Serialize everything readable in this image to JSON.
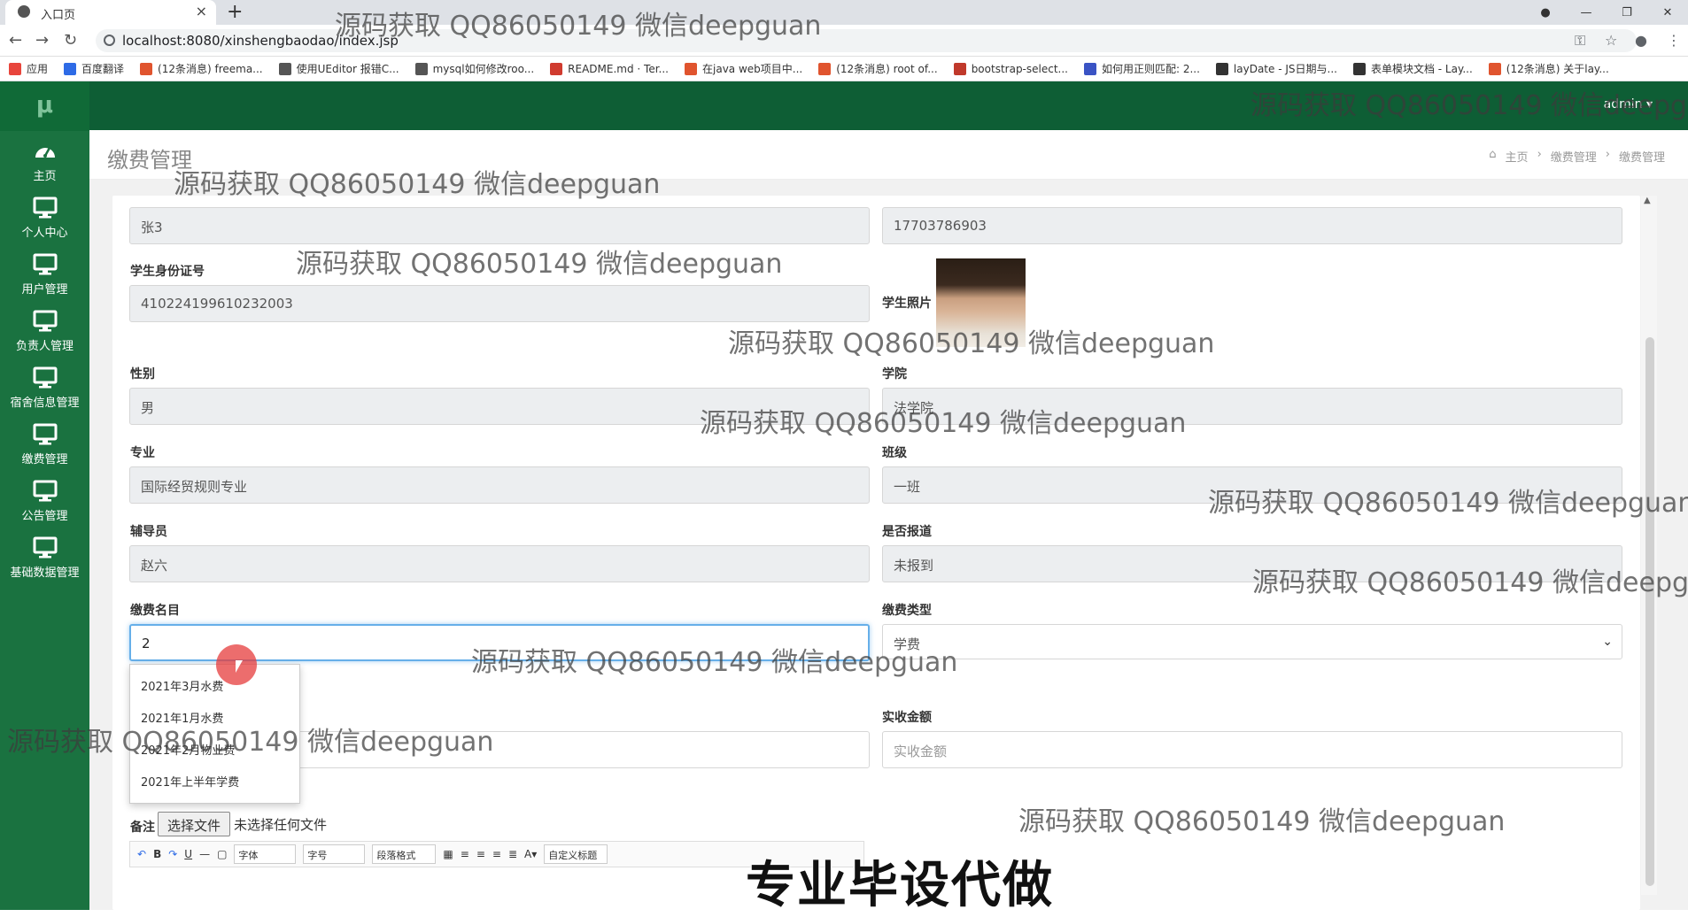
{
  "browser": {
    "tab_title": "入口页",
    "url": "localhost:8080/xinshengbaodao/index.jsp",
    "bookmarks": [
      {
        "label": "应用",
        "color": "#e8453c"
      },
      {
        "label": "百度翻译",
        "color": "#2e6be6"
      },
      {
        "label": "(12条消息) freema...",
        "color": "#e0542e"
      },
      {
        "label": "使用UEditor 报错C...",
        "color": "#555555"
      },
      {
        "label": "mysql如何修改roo...",
        "color": "#555555"
      },
      {
        "label": "README.md · Ter...",
        "color": "#d03b2f"
      },
      {
        "label": "在java web项目中...",
        "color": "#e0542e"
      },
      {
        "label": "(12条消息) root of...",
        "color": "#e0542e"
      },
      {
        "label": "bootstrap-select...",
        "color": "#c0392b"
      },
      {
        "label": "如何用正则匹配: 2...",
        "color": "#3a53c4"
      },
      {
        "label": "layDate - JS日期与...",
        "color": "#333333"
      },
      {
        "label": "表单模块文档 - Lay...",
        "color": "#333333"
      },
      {
        "label": "(12条消息) 关于lay...",
        "color": "#e0542e"
      }
    ]
  },
  "app": {
    "logo": "μ",
    "user": "admin ▾",
    "sidebar": [
      {
        "label": "主页",
        "icon": "dashboard-icon"
      },
      {
        "label": "个人中心",
        "icon": "monitor-icon"
      },
      {
        "label": "用户管理",
        "icon": "monitor-icon"
      },
      {
        "label": "负责人管理",
        "icon": "monitor-icon"
      },
      {
        "label": "宿舍信息管理",
        "icon": "monitor-icon"
      },
      {
        "label": "缴费管理",
        "icon": "monitor-icon"
      },
      {
        "label": "公告管理",
        "icon": "monitor-icon"
      },
      {
        "label": "基础数据管理",
        "icon": "monitor-icon"
      }
    ],
    "page_title": "缴费管理",
    "breadcrumb": [
      "主页",
      "缴费管理",
      "缴费管理"
    ]
  },
  "form": {
    "name_value": "张3",
    "phone_value": "17703786903",
    "idcard_label": "学生身份证号",
    "idcard_value": "410224199610232003",
    "photo_label": "学生照片",
    "gender_label": "性别",
    "gender_value": "男",
    "college_label": "学院",
    "college_value": "法学院",
    "major_label": "专业",
    "major_value": "国际经贸规则专业",
    "class_label": "班级",
    "class_value": "一班",
    "counselor_label": "辅导员",
    "counselor_value": "赵六",
    "reported_label": "是否报道",
    "reported_value": "未报到",
    "fee_item_label": "缴费名目",
    "fee_item_value": "2",
    "fee_type_label": "缴费类型",
    "fee_type_value": "学费",
    "received_label": "实收金额",
    "received_placeholder": "实收金额",
    "autocomplete_options": [
      "2021年3月水费",
      "2021年1月水费",
      "2021年2月物业费",
      "2021年上半年学费"
    ],
    "remark_label": "备注",
    "file_button": "选择文件",
    "file_status": "未选择任何文件",
    "editor": {
      "font_family": "字体",
      "font_size": "字号",
      "paragraph": "段落格式",
      "custom_title": "自定义标题"
    }
  },
  "overlay": {
    "watermark": "源码获取 QQ86050149 微信deepguan",
    "banner": "专业毕设代做"
  }
}
